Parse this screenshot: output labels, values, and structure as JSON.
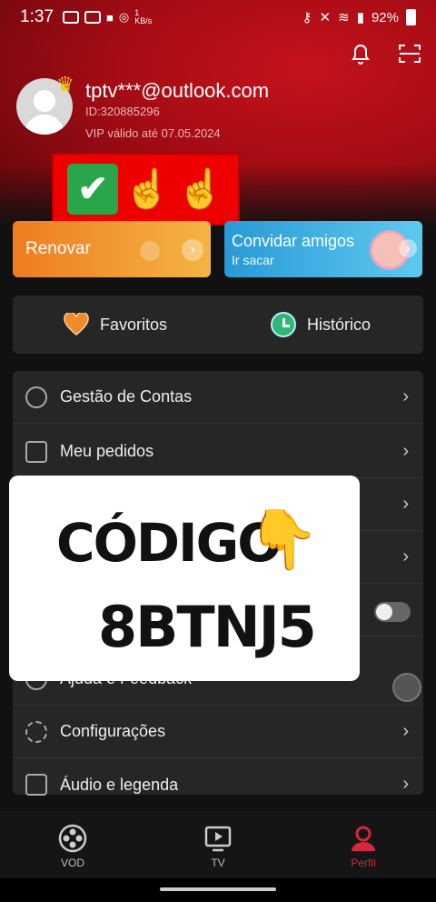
{
  "status_bar": {
    "time": "1:37",
    "network_speed": "1 KB/s",
    "battery": "92%"
  },
  "header": {
    "email": "tptv***@outlook.com",
    "user_id": "ID:320885296",
    "vip_status": "VIP válido até 07.05.2024"
  },
  "promos": {
    "renew_label": "Renovar",
    "invite_label": "Convidar amigos",
    "invite_sub": "Ir sacar"
  },
  "quick_links": {
    "favorites": "Favoritos",
    "history": "Histórico"
  },
  "menu": {
    "items": [
      {
        "label": "Gestão de Contas",
        "icon": "account-icon"
      },
      {
        "label": "Meu pedidos",
        "icon": "orders-icon"
      },
      {
        "label": "Ajuda e Feedback",
        "icon": "help-icon"
      },
      {
        "label": "Configurações",
        "icon": "gear-icon"
      },
      {
        "label": "Áudio e legenda",
        "icon": "subtitle-icon"
      }
    ]
  },
  "overlay": {
    "title": "CÓDIGO",
    "code": "8BTNJ5"
  },
  "tabbar": {
    "tabs": [
      {
        "label": "VOD",
        "icon": "film-reel-icon"
      },
      {
        "label": "TV",
        "icon": "tv-play-icon"
      },
      {
        "label": "Perfil",
        "icon": "profile-icon"
      }
    ],
    "active": "Perfil"
  },
  "colors": {
    "header_red": "#c5121b",
    "renew_orange": "#ef7c22",
    "invite_blue": "#2a9ad6",
    "active_tab": "#d3283f",
    "card_bg": "#262626"
  }
}
